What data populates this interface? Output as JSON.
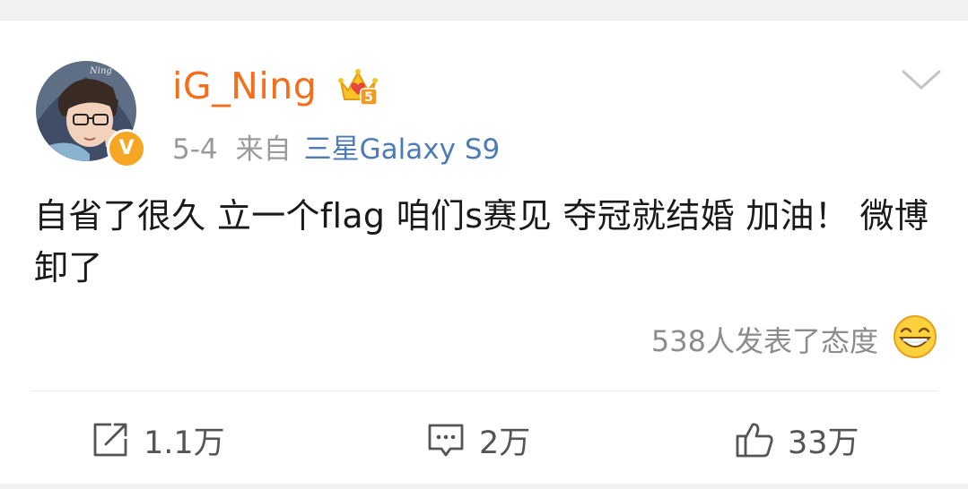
{
  "post": {
    "author": {
      "name": "iG_Ning",
      "verified_icon": "verified-v-icon",
      "verified_text": "V",
      "vip_badge_icon": "crown-vip-icon",
      "vip_level": "5"
    },
    "date": "5-4",
    "source_label": "来自",
    "source_device": "三星Galaxy S9",
    "text": "自省了很久 立一个flag 咱们s赛见 夺冠就结婚 加油！ 微博卸了",
    "attitude_text": "538人发表了态度",
    "actions": {
      "repost_count": "1.1万",
      "comment_count": "2万",
      "like_count": "33万"
    },
    "colors": {
      "username": "#f56e1c",
      "device_link": "#4c7bb5",
      "verified_badge": "#f5a623",
      "meta_gray": "#9a9a9a"
    }
  }
}
